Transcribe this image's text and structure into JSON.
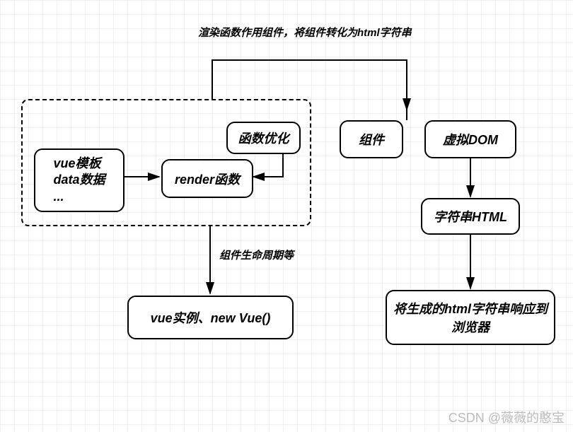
{
  "diagram": {
    "top_label": "渲染函数作用组件，将组件转化为html字符串",
    "vue_template_box": "vue模板\ndata数据\n...",
    "render_box": "render函数",
    "optimize_box": "函数优化",
    "lifecycle_label": "组件生命周期等",
    "vue_instance_box": "vue实例、new Vue()",
    "component_box": "组件",
    "vdom_box": "虚拟DOM",
    "html_string_box": "字符串HTML",
    "response_box": "将生成的html字符串响应到浏览器"
  },
  "watermark": "CSDN @薇薇的憨宝"
}
